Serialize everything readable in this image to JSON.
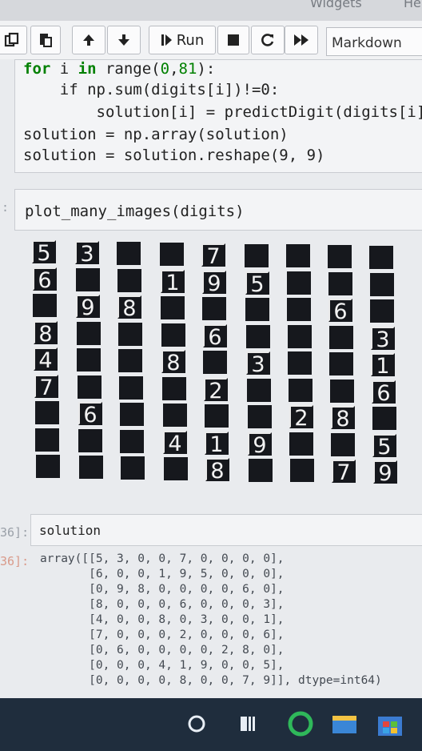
{
  "menu": {
    "items": [
      "Widgets",
      "He"
    ]
  },
  "toolbar": {
    "run_label": "Run",
    "cell_type": "Markdown",
    "icons": [
      "copy-icon",
      "paste-icon",
      "move-up-icon",
      "move-down-icon",
      "run-icon",
      "stop-icon",
      "restart-icon",
      "fast-forward-icon"
    ]
  },
  "code_cell": {
    "lines": [
      {
        "a": "for",
        "b": " i ",
        "c": "in",
        "d": " range(",
        "e": "0",
        "f": ",",
        "g": "81",
        "h": "):"
      },
      {
        "text": "    if np.sum(digits[i])!=0:"
      },
      {
        "text": "        solution[i] = predictDigit(digits[i]"
      },
      {
        "text": "solution = np.array(solution)"
      },
      {
        "text": "solution = solution.reshape(9, 9)"
      }
    ]
  },
  "plot_cell": {
    "prompt": ":",
    "code": "plot_many_images(digits)"
  },
  "digit_grid": {
    "rows": [
      [
        5,
        3,
        0,
        0,
        7,
        0,
        0,
        0,
        0
      ],
      [
        6,
        0,
        0,
        1,
        9,
        5,
        0,
        0,
        0
      ],
      [
        0,
        9,
        8,
        0,
        0,
        0,
        0,
        6,
        0
      ],
      [
        8,
        0,
        0,
        0,
        6,
        0,
        0,
        0,
        3
      ],
      [
        4,
        0,
        0,
        8,
        0,
        3,
        0,
        0,
        1
      ],
      [
        7,
        0,
        0,
        0,
        2,
        0,
        0,
        0,
        6
      ],
      [
        0,
        6,
        0,
        0,
        0,
        0,
        2,
        8,
        0
      ],
      [
        0,
        0,
        0,
        4,
        1,
        9,
        0,
        0,
        5
      ],
      [
        0,
        0,
        0,
        0,
        8,
        0,
        0,
        7,
        9
      ]
    ]
  },
  "solution_cell": {
    "prompt": "36]:",
    "code": "solution"
  },
  "output_cell": {
    "prompt": "36]:",
    "lines": [
      "array([[5, 3, 0, 0, 7, 0, 0, 0, 0],",
      "       [6, 0, 0, 1, 9, 5, 0, 0, 0],",
      "       [0, 9, 8, 0, 0, 0, 0, 6, 0],",
      "       [8, 0, 0, 0, 6, 0, 0, 0, 3],",
      "       [4, 0, 0, 8, 0, 3, 0, 0, 1],",
      "       [7, 0, 0, 0, 2, 0, 0, 0, 6],",
      "       [0, 6, 0, 0, 0, 0, 2, 8, 0],",
      "       [0, 0, 0, 4, 1, 9, 0, 0, 5],",
      "       [0, 0, 0, 0, 8, 0, 0, 7, 9]], dtype=int64)"
    ]
  },
  "taskbar": {
    "icons": [
      "cortana-icon",
      "task-view-icon",
      "chrome-icon",
      "file-explorer-icon",
      "store-icon"
    ]
  }
}
